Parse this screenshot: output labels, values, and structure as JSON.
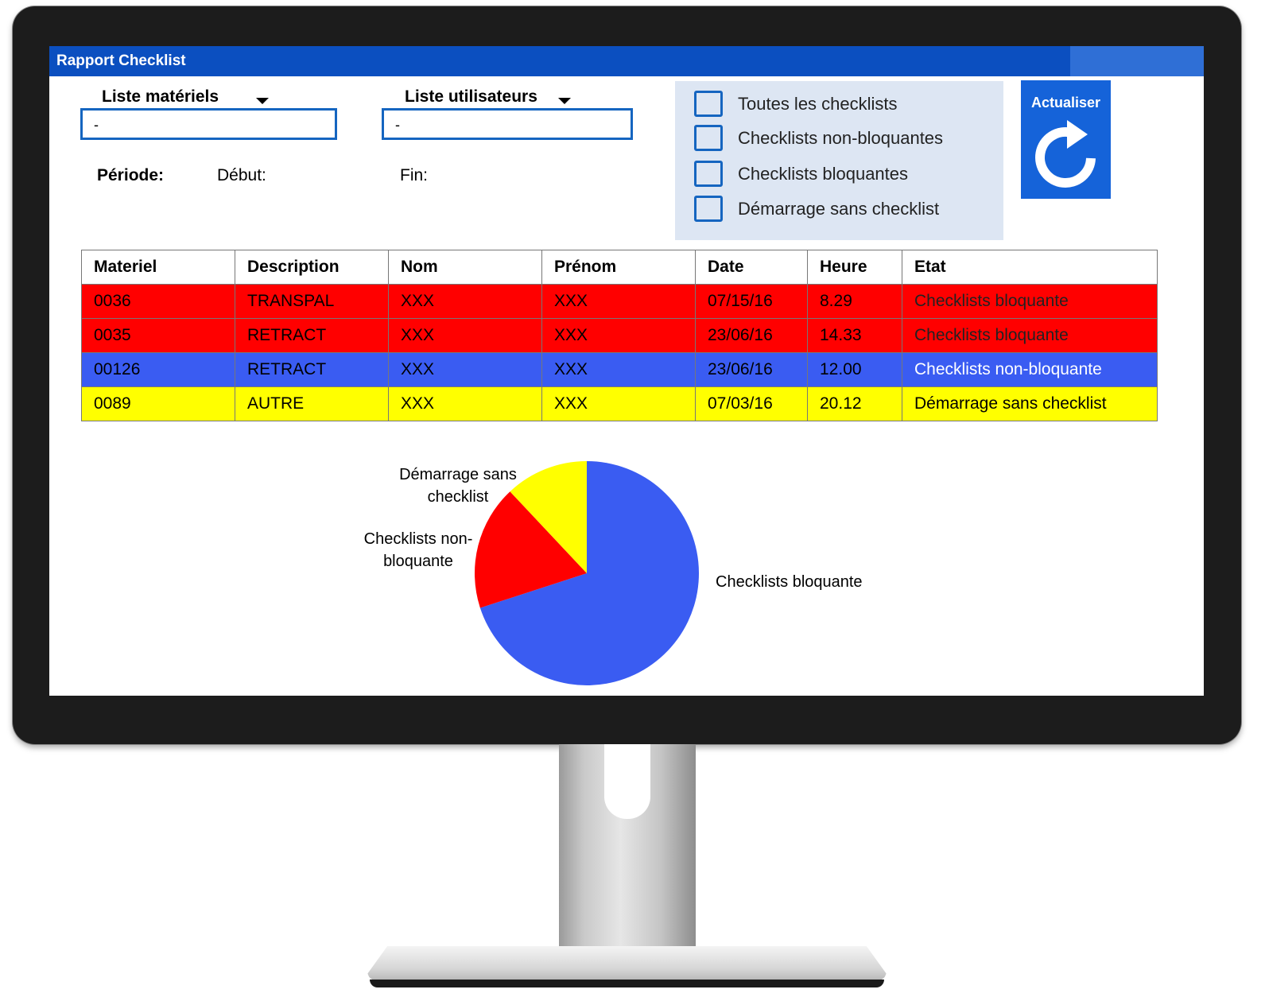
{
  "app": {
    "title": "Rapport Checklist"
  },
  "filters": {
    "materials": {
      "label": "Liste matériels",
      "value": "-"
    },
    "users": {
      "label": "Liste utilisateurs",
      "value": "-"
    },
    "period": {
      "label": "Période:",
      "start_label": "Début:",
      "end_label": "Fin:"
    }
  },
  "checkboxes": [
    {
      "label": "Toutes les checklists"
    },
    {
      "label": "Checklists non-bloquantes"
    },
    {
      "label": "Checklists bloquantes"
    },
    {
      "label": "Démarrage sans checklist"
    }
  ],
  "refresh": {
    "label": "Actualiser",
    "icon": "refresh-icon"
  },
  "table": {
    "columns": [
      "Materiel",
      "Description",
      "Nom",
      "Prénom",
      "Date",
      "Heure",
      "Etat"
    ],
    "rows": [
      {
        "status": "red",
        "cells": [
          "0036",
          "TRANSPAL",
          "XXX",
          "XXX",
          "07/15/16",
          "8.29",
          "Checklists bloquante"
        ]
      },
      {
        "status": "red",
        "cells": [
          "0035",
          "RETRACT",
          "XXX",
          "XXX",
          "23/06/16",
          "14.33",
          "Checklists bloquante"
        ]
      },
      {
        "status": "blue",
        "cells": [
          "00126",
          "RETRACT",
          "XXX",
          "XXX",
          "23/06/16",
          "12.00",
          "Checklists non-bloquante"
        ]
      },
      {
        "status": "yellow",
        "cells": [
          "0089",
          "AUTRE",
          "XXX",
          "XXX",
          "07/03/16",
          "20.12",
          "Démarrage sans checklist"
        ]
      }
    ]
  },
  "colors": {
    "blocking": "#ff0000",
    "non_blocking": "#3a5cf2",
    "no_checklist": "#ffff00",
    "accent": "#0b4fc0"
  },
  "chart_data": {
    "type": "pie",
    "categories": [
      "Checklists bloquante",
      "Checklists non-bloquante",
      "Démarrage sans checklist"
    ],
    "values": [
      70,
      18,
      12
    ],
    "colors": [
      "#3a5cf2",
      "#ff0000",
      "#ffff00"
    ],
    "labels": [
      {
        "lines": [
          "Checklists bloquante"
        ]
      },
      {
        "lines": [
          "Checklists non-",
          "bloquante"
        ]
      },
      {
        "lines": [
          "Démarrage sans",
          "checklist"
        ]
      }
    ],
    "legend": "none"
  }
}
